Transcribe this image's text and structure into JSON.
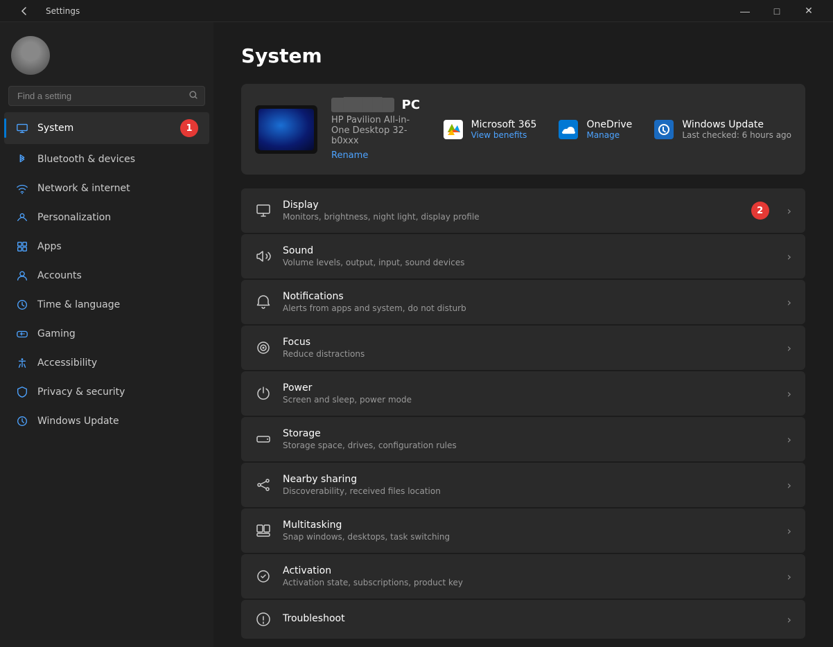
{
  "titlebar": {
    "title": "Settings",
    "back_icon": "←",
    "minimize": "—",
    "maximize": "□",
    "close": "✕"
  },
  "sidebar": {
    "search_placeholder": "Find a setting",
    "nav_items": [
      {
        "id": "system",
        "label": "System",
        "active": true
      },
      {
        "id": "bluetooth",
        "label": "Bluetooth & devices",
        "active": false
      },
      {
        "id": "network",
        "label": "Network & internet",
        "active": false
      },
      {
        "id": "personalization",
        "label": "Personalization",
        "active": false
      },
      {
        "id": "apps",
        "label": "Apps",
        "active": false
      },
      {
        "id": "accounts",
        "label": "Accounts",
        "active": false
      },
      {
        "id": "time",
        "label": "Time & language",
        "active": false
      },
      {
        "id": "gaming",
        "label": "Gaming",
        "active": false
      },
      {
        "id": "accessibility",
        "label": "Accessibility",
        "active": false
      },
      {
        "id": "privacy",
        "label": "Privacy & security",
        "active": false
      },
      {
        "id": "windowsupdate",
        "label": "Windows Update",
        "active": false
      }
    ]
  },
  "main": {
    "page_title": "System",
    "pc_name": "PC",
    "pc_model": "HP Pavilion All-in-One Desktop 32-b0xxx",
    "pc_rename": "Rename",
    "shortcuts": [
      {
        "id": "ms365",
        "title": "Microsoft 365",
        "action": "View benefits"
      },
      {
        "id": "onedrive",
        "title": "OneDrive",
        "action": "Manage"
      },
      {
        "id": "winupdate2",
        "title": "Windows Update",
        "action": "Last checked: 6 hours ago"
      }
    ],
    "settings": [
      {
        "id": "display",
        "title": "Display",
        "desc": "Monitors, brightness, night light, display profile"
      },
      {
        "id": "sound",
        "title": "Sound",
        "desc": "Volume levels, output, input, sound devices"
      },
      {
        "id": "notifications",
        "title": "Notifications",
        "desc": "Alerts from apps and system, do not disturb"
      },
      {
        "id": "focus",
        "title": "Focus",
        "desc": "Reduce distractions"
      },
      {
        "id": "power",
        "title": "Power",
        "desc": "Screen and sleep, power mode"
      },
      {
        "id": "storage",
        "title": "Storage",
        "desc": "Storage space, drives, configuration rules"
      },
      {
        "id": "nearbysharing",
        "title": "Nearby sharing",
        "desc": "Discoverability, received files location"
      },
      {
        "id": "multitasking",
        "title": "Multitasking",
        "desc": "Snap windows, desktops, task switching"
      },
      {
        "id": "activation",
        "title": "Activation",
        "desc": "Activation state, subscriptions, product key"
      },
      {
        "id": "troubleshoot",
        "title": "Troubleshoot",
        "desc": ""
      }
    ],
    "annotation1": "1",
    "annotation2": "2"
  }
}
